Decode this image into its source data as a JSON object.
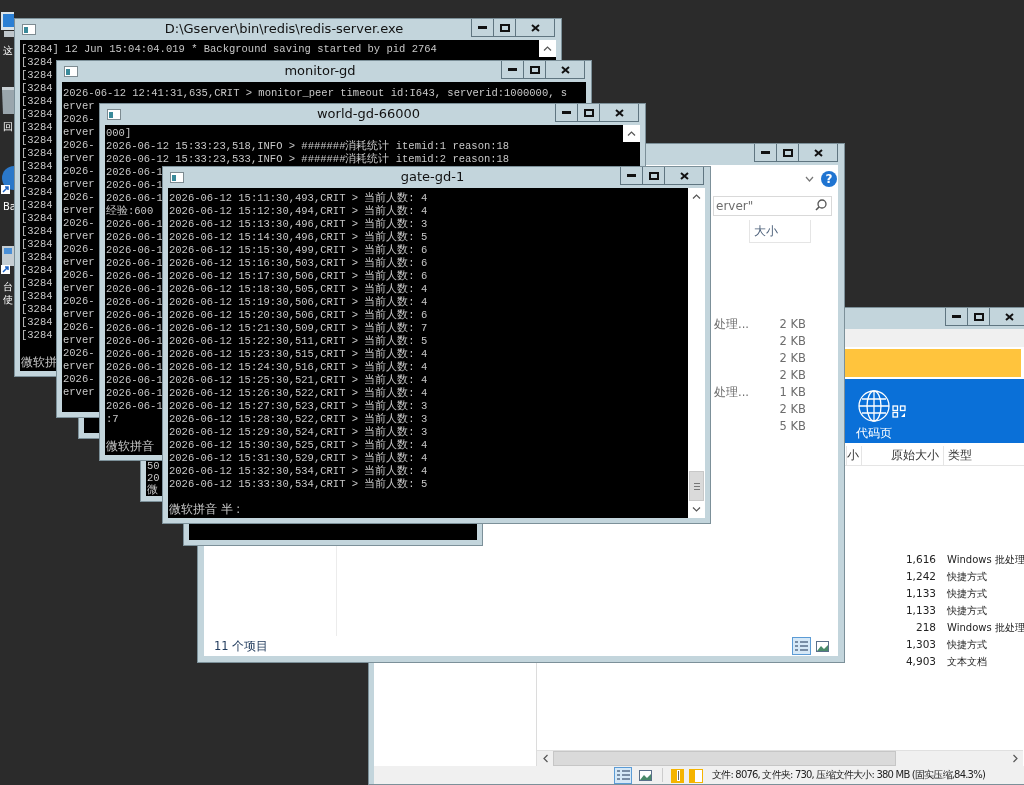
{
  "desktop_icons": [
    {
      "label_lines": [
        "这"
      ]
    },
    {
      "label_lines": [
        "回"
      ]
    },
    {
      "label_lines": [
        "Ba"
      ]
    },
    {
      "label_lines": [
        "台",
        "使"
      ]
    }
  ],
  "windows": [
    {
      "kind": "archive",
      "ribbon_button": {
        "label": "代码页"
      },
      "column_headers": [
        "小",
        "原始大小",
        "类型"
      ],
      "files": [
        {
          "original_size": "1,616",
          "type": "Windows 批处理"
        },
        {
          "original_size": "1,242",
          "type": "快捷方式"
        },
        {
          "original_size": "1,133",
          "type": "快捷方式"
        },
        {
          "original_size": "1,133",
          "type": "快捷方式"
        },
        {
          "original_size": "218",
          "type": "Windows 批处理"
        },
        {
          "original_size": "1,303",
          "type": "快捷方式"
        },
        {
          "original_size": "4,903",
          "type": "文本文档"
        }
      ],
      "status_views": [
        {
          "selected": true
        },
        {
          "selected": false
        }
      ],
      "status_text": "文件: 8076, 文件夹: 730, 压缩文件大小: 380 MB (固实压缩,84.3%)"
    },
    {
      "kind": "explorer",
      "help": "?",
      "search": {
        "placeholder": "erver\""
      },
      "column_headers": [
        "大小"
      ],
      "files": [
        {
          "type": "处理...",
          "size": "2 KB"
        },
        {
          "size": "2 KB"
        },
        {
          "size": "2 KB"
        },
        {
          "size": "2 KB"
        },
        {
          "type": "处理...",
          "size": "1 KB"
        },
        {
          "size": "2 KB"
        },
        {
          "size": "5 KB"
        }
      ],
      "item_count": "11 个项目",
      "view_buttons": [
        {
          "selected": true
        },
        {
          "selected": false
        }
      ]
    },
    {
      "kind": "console",
      "title": "D:\\Gserver\\bin\\redis\\redis-server.exe",
      "lines": [
        "[3284] 12 Jun 15:04:04.019 * Background saving started by pid 2764",
        "[3284",
        "[3284",
        "[3284",
        "[3284",
        "[3284",
        "[3284",
        "[3284",
        "[3284",
        "[3284",
        "[3284",
        "[3284",
        "[3284",
        "[3284",
        "[3284",
        "[3284",
        "[3284",
        "[3284",
        "[3284",
        "[3284",
        "[3284",
        "[3284",
        "[3284"
      ],
      "ime": "微软拼"
    },
    {
      "kind": "console"
    },
    {
      "kind": "console",
      "title": "monitor-gd",
      "lines": [
        "2026-06-12 12:41:31,635,CRIT > monitor_peer timeout id:I643, serverid:1000000, s",
        "erver",
        "2026-",
        "erver",
        "2026-",
        "erver",
        "2026-",
        "erver",
        "2026-",
        "erver",
        "2026-",
        "erver",
        "2026-",
        "erver",
        "2026-",
        "erver",
        "2026-",
        "erver",
        "2026-",
        "erver",
        "2026-",
        "erver",
        "2026-",
        "erver"
      ]
    },
    {
      "kind": "console",
      "lines": [
        "50",
        "20",
        "微"
      ]
    },
    {
      "kind": "console"
    },
    {
      "kind": "console",
      "title": "world-gd-66000",
      "lines": [
        "000]",
        "2026-06-12 15:33:23,518,INFO > #######消耗统计 itemid:1 reason:18",
        "2026-06-12 15:33:23,533,INFO > #######消耗统计 itemid:2 reason:18",
        "2026-06-1",
        "2026-06-1",
        "2026-06-1",
        "经验:600",
        "2026-06-1",
        "2026-06-1",
        "2026-06-1",
        "2026-06-1",
        "2026-06-1",
        "2026-06-1",
        "2026-06-1",
        "2026-06-1",
        "2026-06-1",
        "2026-06-1",
        "2026-06-1",
        "2026-06-1",
        "2026-06-1",
        "2026-06-1",
        "2026-06-1",
        ":7"
      ],
      "ime": "微软拼音"
    },
    {
      "kind": "console",
      "title": "gate-gd-1",
      "lines": [
        "2026-06-12 15:11:30,493,CRIT > 当前人数: 4",
        "2026-06-12 15:12:30,494,CRIT > 当前人数: 4",
        "2026-06-12 15:13:30,496,CRIT > 当前人数: 3",
        "2026-06-12 15:14:30,496,CRIT > 当前人数: 5",
        "2026-06-12 15:15:30,499,CRIT > 当前人数: 6",
        "2026-06-12 15:16:30,503,CRIT > 当前人数: 6",
        "2026-06-12 15:17:30,506,CRIT > 当前人数: 6",
        "2026-06-12 15:18:30,505,CRIT > 当前人数: 4",
        "2026-06-12 15:19:30,506,CRIT > 当前人数: 4",
        "2026-06-12 15:20:30,506,CRIT > 当前人数: 6",
        "2026-06-12 15:21:30,509,CRIT > 当前人数: 7",
        "2026-06-12 15:22:30,511,CRIT > 当前人数: 5",
        "2026-06-12 15:23:30,515,CRIT > 当前人数: 4",
        "2026-06-12 15:24:30,516,CRIT > 当前人数: 4",
        "2026-06-12 15:25:30,521,CRIT > 当前人数: 4",
        "2026-06-12 15:26:30,522,CRIT > 当前人数: 4",
        "2026-06-12 15:27:30,523,CRIT > 当前人数: 3",
        "2026-06-12 15:28:30,522,CRIT > 当前人数: 3",
        "2026-06-12 15:29:30,524,CRIT > 当前人数: 3",
        "2026-06-12 15:30:30,525,CRIT > 当前人数: 4",
        "2026-06-12 15:31:30,529,CRIT > 当前人数: 4",
        "2026-06-12 15:32:30,534,CRIT > 当前人数: 4",
        "2026-06-12 15:33:30,534,CRIT > 当前人数: 5"
      ],
      "ime": "微软拼音 半 :"
    }
  ]
}
